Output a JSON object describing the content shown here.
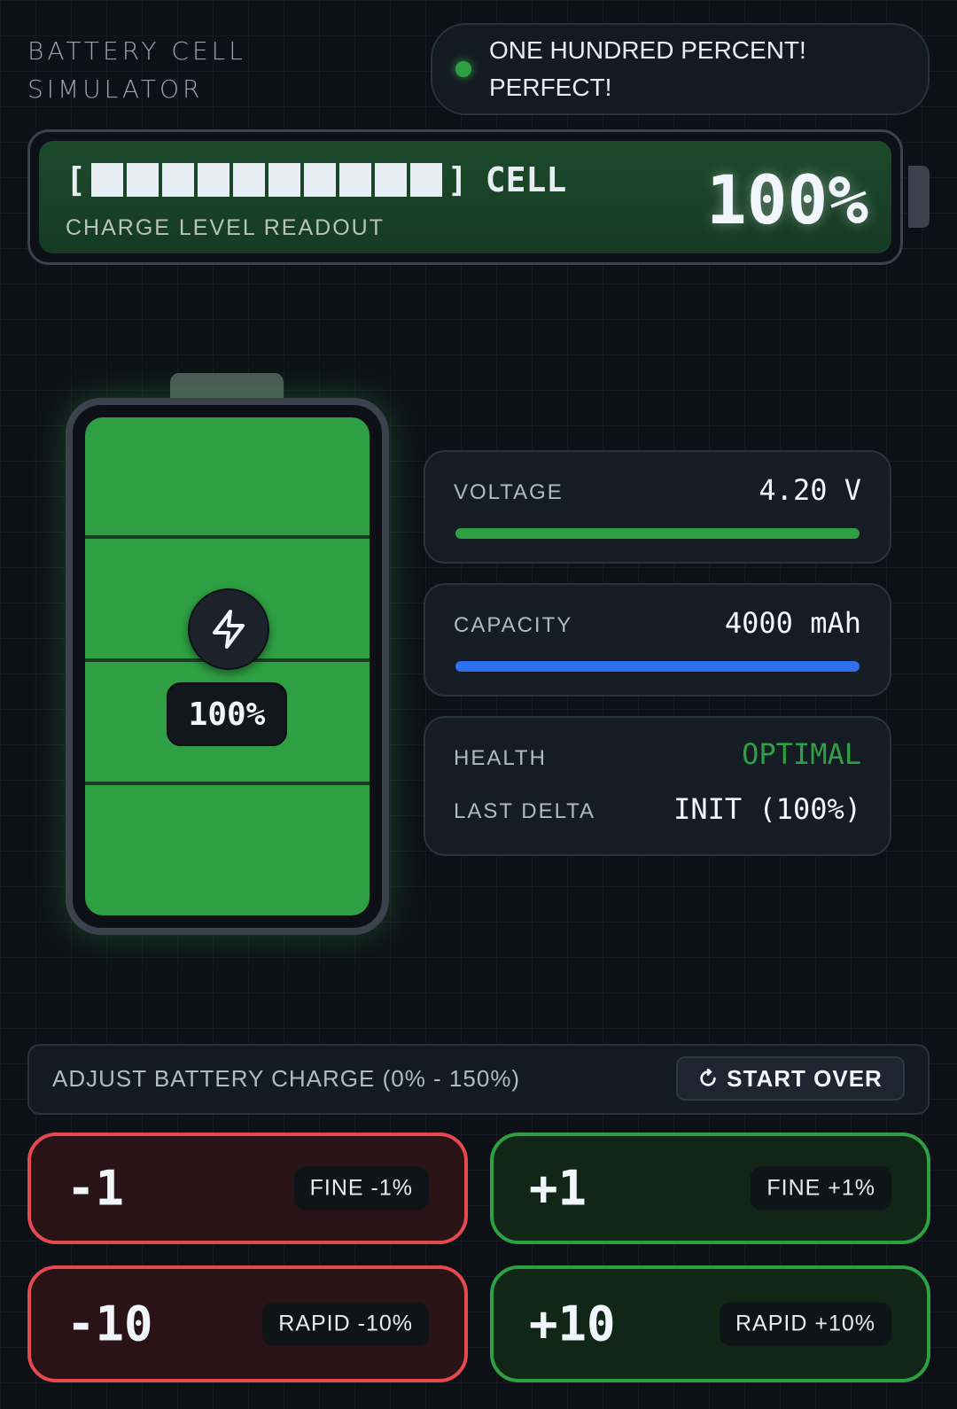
{
  "header": {
    "title": "BATTERY CELL SIMULATOR",
    "status_message": "ONE HUNDRED PERCENT! PERFECT!",
    "status_color": "#2ea043"
  },
  "readout": {
    "bar_open": "[",
    "bar_close": "]",
    "segments_filled": 10,
    "segments_total": 10,
    "cell_label": "CELL",
    "subtitle": "CHARGE LEVEL READOUT",
    "percent": "100%"
  },
  "battery": {
    "charge_fraction": 1.0,
    "percent_badge": "100%",
    "icon": "lightning-bolt-icon",
    "fill_color": "#2ea043"
  },
  "stats": {
    "voltage_label": "VOLTAGE",
    "voltage_value": "4.20 V",
    "voltage_fraction": 1.0,
    "voltage_color": "#2ea043",
    "capacity_label": "CAPACITY",
    "capacity_value": "4000 mAh",
    "capacity_fraction": 1.0,
    "capacity_color": "#2f6fed",
    "health_label": "HEALTH",
    "health_value": "OPTIMAL",
    "health_color": "#2ea043",
    "delta_label": "LAST DELTA",
    "delta_value": "INIT (100%)"
  },
  "controls": {
    "adjust_label": "ADJUST BATTERY CHARGE (0% - 150%)",
    "start_over_label": "START OVER",
    "start_over_icon": "refresh-icon",
    "minus1_value": "-1",
    "minus1_tag": "FINE -1%",
    "plus1_value": "+1",
    "plus1_tag": "FINE +1%",
    "minus10_value": "-10",
    "minus10_tag": "RAPID -10%",
    "plus10_value": "+10",
    "plus10_tag": "RAPID +10%",
    "decrease_color": "#e5484d",
    "increase_color": "#2ea043"
  }
}
